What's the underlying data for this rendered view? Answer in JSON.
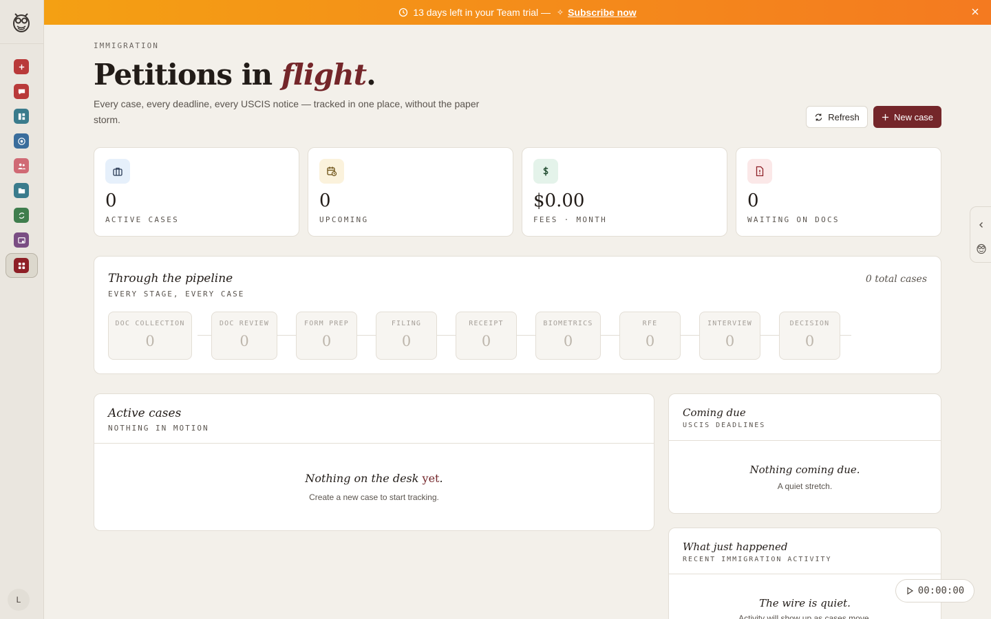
{
  "banner": {
    "trial_text": "13 days left in your Team trial —",
    "spark": "✧",
    "subscribe_label": "Subscribe now"
  },
  "sidebar": {
    "items": [
      {
        "name": "add-icon",
        "color": "#b93a3a"
      },
      {
        "name": "chat-icon",
        "color": "#b93a3a"
      },
      {
        "name": "dashboard-icon",
        "color": "#3a7b8c"
      },
      {
        "name": "target-icon",
        "color": "#3a6d9c"
      },
      {
        "name": "people-icon",
        "color": "#d06a75"
      },
      {
        "name": "folder-icon",
        "color": "#3a7b8c"
      },
      {
        "name": "refresh-icon",
        "color": "#3f7d4d"
      },
      {
        "name": "image-icon",
        "color": "#7a4d83"
      },
      {
        "name": "grid-icon",
        "color": "#8e1f26",
        "active": true
      }
    ],
    "avatar_initial": "L"
  },
  "header": {
    "eyebrow": "IMMIGRATION",
    "title_prefix": "Petitions in ",
    "title_accent": "flight",
    "title_suffix": ".",
    "description": "Every case, every deadline, every USCIS notice — tracked in one place, without the paper storm.",
    "refresh_label": "Refresh",
    "new_case_label": "New case"
  },
  "stats": [
    {
      "value": "0",
      "label": "ACTIVE CASES",
      "icon": "briefcase-icon",
      "bg": "#e6f0fb",
      "fg": "#2a3a55"
    },
    {
      "value": "0",
      "label": "UPCOMING",
      "icon": "calendar-clock-icon",
      "bg": "#fbf2dc",
      "fg": "#6a4e12"
    },
    {
      "value": "$0.00",
      "label": "FEES · MONTH",
      "icon": "dollar-icon",
      "bg": "#e4f3ea",
      "fg": "#1f4a2e"
    },
    {
      "value": "0",
      "label": "WAITING ON DOCS",
      "icon": "doc-alert-icon",
      "bg": "#fbe8e8",
      "fg": "#8e1f26"
    }
  ],
  "pipeline": {
    "title": "Through the pipeline",
    "subtitle": "EVERY STAGE, EVERY CASE",
    "total": "0 total cases",
    "stages": [
      {
        "label": "DOC COLLECTION",
        "count": "0"
      },
      {
        "label": "DOC REVIEW",
        "count": "0"
      },
      {
        "label": "FORM PREP",
        "count": "0"
      },
      {
        "label": "FILING",
        "count": "0"
      },
      {
        "label": "RECEIPT",
        "count": "0"
      },
      {
        "label": "BIOMETRICS",
        "count": "0"
      },
      {
        "label": "RFE",
        "count": "0"
      },
      {
        "label": "INTERVIEW",
        "count": "0"
      },
      {
        "label": "DECISION",
        "count": "0"
      }
    ]
  },
  "active_cases": {
    "title": "Active cases",
    "subtitle": "NOTHING IN MOTION",
    "empty_title_prefix": "Nothing on the desk ",
    "empty_title_accent": "yet",
    "empty_title_suffix": ".",
    "empty_sub": "Create a new case to start tracking."
  },
  "coming_due": {
    "title": "Coming due",
    "subtitle": "USCIS DEADLINES",
    "empty_title": "Nothing coming due.",
    "empty_sub": "A quiet stretch."
  },
  "activity": {
    "title": "What just happened",
    "subtitle": "RECENT IMMIGRATION ACTIVITY",
    "empty_title": "The wire is quiet.",
    "empty_sub": "Activity will show up as cases move."
  },
  "timer": {
    "value": "00:00:00"
  }
}
